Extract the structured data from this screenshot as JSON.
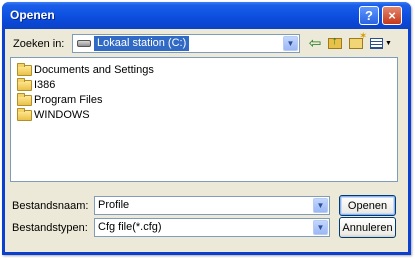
{
  "window": {
    "title": "Openen"
  },
  "titlebar": {
    "help_symbol": "?",
    "close_symbol": "×"
  },
  "lookin": {
    "label": "Zoeken in:",
    "value": "Lokaal station (C:)",
    "icon": "drive-icon"
  },
  "toolbar": {
    "back_icon": "back-arrow-icon",
    "up_icon": "up-one-level-icon",
    "new_folder_icon": "new-folder-icon",
    "views_icon": "views-menu-icon",
    "back_symbol": "⇦"
  },
  "files": [
    {
      "name": "Documents and Settings",
      "icon": "folder-icon"
    },
    {
      "name": "I386",
      "icon": "folder-icon"
    },
    {
      "name": "Program Files",
      "icon": "folder-icon"
    },
    {
      "name": "WINDOWS",
      "icon": "folder-icon"
    }
  ],
  "filename": {
    "label": "Bestandsnaam:",
    "value": "Profile"
  },
  "filetype": {
    "label": "Bestandstypen:",
    "value": "Cfg file(*.cfg)"
  },
  "buttons": {
    "open": "Openen",
    "cancel": "Annuleren"
  },
  "colors": {
    "titlebar": "#0a47d6",
    "selection": "#316ac5",
    "dialog_bg": "#ece9d8"
  }
}
